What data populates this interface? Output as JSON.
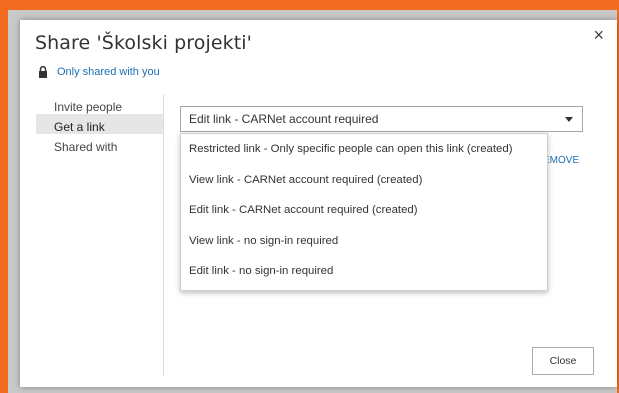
{
  "dialog": {
    "title": "Share 'Školski projekti'",
    "close_glyph": "×"
  },
  "privacy": {
    "icon": "lock-icon",
    "label": "Only shared with you"
  },
  "nav": {
    "items": [
      {
        "label": "Invite people"
      },
      {
        "label": "Get a link"
      },
      {
        "label": "Shared with"
      }
    ]
  },
  "link_select": {
    "selected": "Edit link - CARNet account required",
    "options": [
      "Restricted link - Only specific people can open this link (created)",
      "View link - CARNet account required (created)",
      "Edit link - CARNet account required (created)",
      "View link - no sign-in required",
      "Edit link - no sign-in required"
    ]
  },
  "remove_label": "EMOVE",
  "footer": {
    "close_label": "Close"
  },
  "colors": {
    "background": "#f26d21",
    "link": "#1f6fb5"
  }
}
